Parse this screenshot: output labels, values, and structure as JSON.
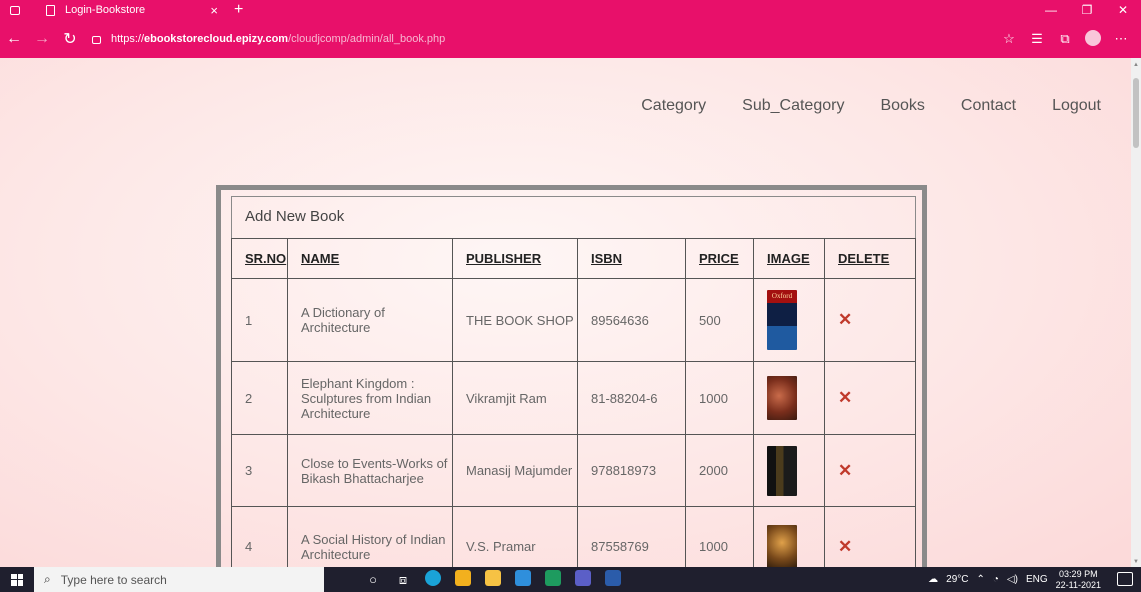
{
  "browser": {
    "tab_title": "Login-Bookstore",
    "tab_close": "×",
    "new_tab": "+",
    "url_scheme": "https://",
    "url_host": "ebookstorecloud.epizy.com",
    "url_path": "/cloudjcomp/admin/all_book.php"
  },
  "nav": {
    "items": [
      "Category",
      "Sub_Category",
      "Books",
      "Contact",
      "Logout"
    ]
  },
  "panel": {
    "title": "Add New Book"
  },
  "table": {
    "headers": [
      "SR.NO",
      "NAME",
      "PUBLISHER",
      "ISBN",
      "PRICE",
      "IMAGE",
      "DELETE"
    ],
    "rows": [
      {
        "sr": "1",
        "name": "A Dictionary of Architecture",
        "publisher": "THE BOOK SHOP",
        "isbn": "89564636",
        "price": "500",
        "image_label": "Oxford",
        "delete": "✕"
      },
      {
        "sr": "2",
        "name": "Elephant Kingdom : Sculptures from Indian Architecture",
        "publisher": "Vikramjit Ram",
        "isbn": "81-88204-6",
        "price": "1000",
        "delete": "✕"
      },
      {
        "sr": "3",
        "name": "Close to Events-Works of Bikash Bhattacharjee",
        "publisher": "Manasij Majumder",
        "isbn": "978818973",
        "price": "2000",
        "delete": "✕"
      },
      {
        "sr": "4",
        "name": "A Social History of Indian Architecture",
        "publisher": "V.S. Pramar",
        "isbn": "87558769",
        "price": "1000",
        "delete": "✕"
      }
    ]
  },
  "taskbar": {
    "search_placeholder": "Type here to search",
    "weather": "29°C",
    "lang": "ENG",
    "time": "03:29 PM",
    "date": "22-11-2021"
  },
  "colors": {
    "chrome": "#e8106a",
    "delete": "#c0392b"
  }
}
